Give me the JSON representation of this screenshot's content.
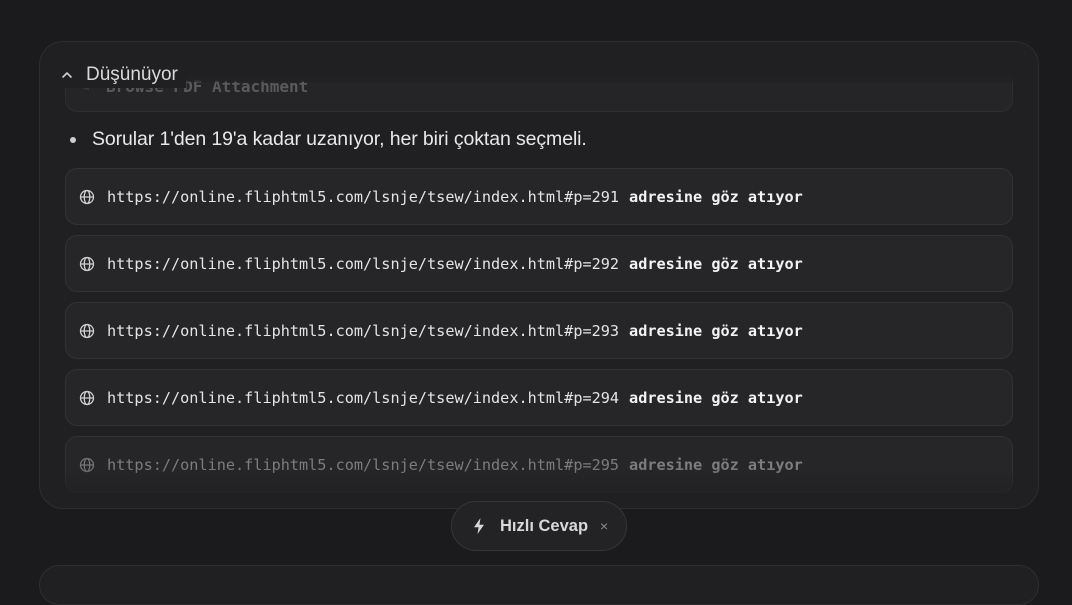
{
  "thinking": {
    "header_label": "Düşünüyor",
    "collapsed_item_text": "Browse PDF Attachment",
    "bullet_text": "Sorular 1'den 19'a kadar uzanıyor, her biri çoktan seçmeli.",
    "rows": [
      {
        "url": "https://online.fliphtml5.com/lsnje/tsew/index.html#p=291",
        "action": "adresine göz atıyor"
      },
      {
        "url": "https://online.fliphtml5.com/lsnje/tsew/index.html#p=292",
        "action": "adresine göz atıyor"
      },
      {
        "url": "https://online.fliphtml5.com/lsnje/tsew/index.html#p=293",
        "action": "adresine göz atıyor"
      },
      {
        "url": "https://online.fliphtml5.com/lsnje/tsew/index.html#p=294",
        "action": "adresine göz atıyor"
      },
      {
        "url": "https://online.fliphtml5.com/lsnje/tsew/index.html#p=295",
        "action": "adresine göz atıyor"
      }
    ]
  },
  "quick_reply": {
    "label": "Hızlı Cevap",
    "close_glyph": "×"
  },
  "icons": {
    "header": "chevron-up-icon",
    "row": "globe-icon",
    "quick": "lightning-icon"
  }
}
